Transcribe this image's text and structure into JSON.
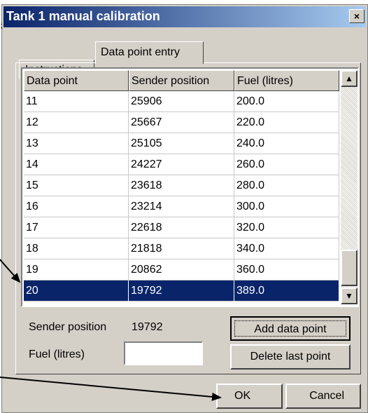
{
  "window": {
    "title": "Tank 1 manual calibration",
    "close_glyph": "×"
  },
  "tabs": [
    {
      "label": "Instructions",
      "active": false
    },
    {
      "label": "Data point entry",
      "active": true
    }
  ],
  "table": {
    "columns": [
      "Data point",
      "Sender position",
      "Fuel (litres)"
    ],
    "rows": [
      [
        "11",
        "25906",
        "200.0"
      ],
      [
        "12",
        "25667",
        "220.0"
      ],
      [
        "13",
        "25105",
        "240.0"
      ],
      [
        "14",
        "24227",
        "260.0"
      ],
      [
        "15",
        "23618",
        "280.0"
      ],
      [
        "16",
        "23214",
        "300.0"
      ],
      [
        "17",
        "22618",
        "320.0"
      ],
      [
        "18",
        "21818",
        "340.0"
      ],
      [
        "19",
        "20862",
        "360.0"
      ],
      [
        "20",
        "19792",
        "389.0"
      ]
    ],
    "selected_row": 9
  },
  "scrollbar": {
    "up_glyph": "▲",
    "down_glyph": "▼"
  },
  "fields": {
    "sender_label": "Sender position",
    "sender_value": "19792",
    "fuel_label": "Fuel (litres)",
    "fuel_value": ""
  },
  "buttons": {
    "add": "Add data point",
    "delete": "Delete last point",
    "ok": "OK",
    "cancel": "Cancel"
  },
  "colors": {
    "title_start": "#0a246a",
    "title_end": "#a6caf0",
    "selection": "#0a246a",
    "dialog_face": "#d4d0c8"
  },
  "icons": [
    "close-icon",
    "scroll-up-icon",
    "scroll-down-icon",
    "annotation-arrow-icon"
  ]
}
